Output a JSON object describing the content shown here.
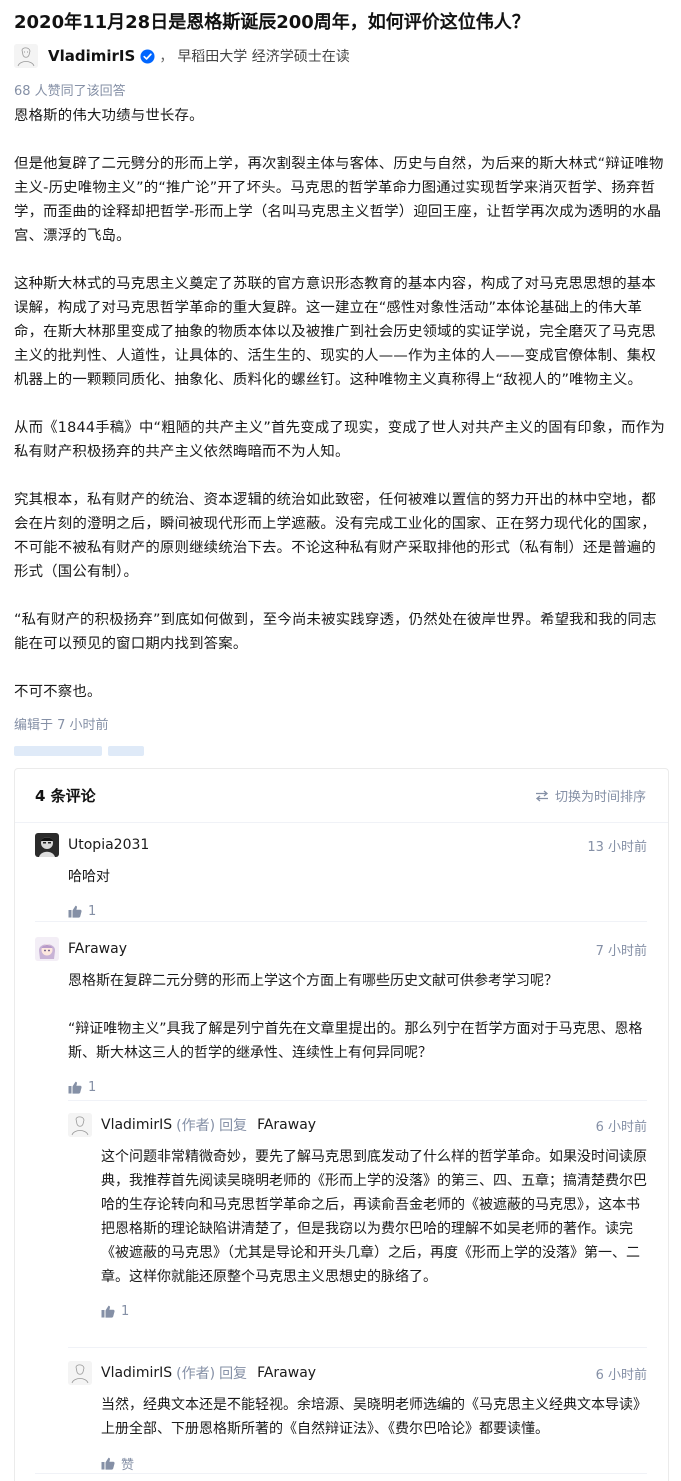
{
  "question": {
    "title": "2020年11月28日是恩格斯诞辰200周年，如何评价这位伟人？"
  },
  "author": {
    "name": "VladimirIS",
    "separator": "，",
    "bio": "早稻田大学 经济学硕士在读"
  },
  "answer": {
    "vote_summary": "68 人赞同了该回答",
    "paragraphs": [
      "恩格斯的伟大功绩与世长存。",
      "但是他复辟了二元劈分的形而上学，再次割裂主体与客体、历史与自然，为后来的斯大林式“辩证唯物主义-历史唯物主义”的“推广论”开了坏头。马克思的哲学革命力图通过实现哲学来消灭哲学、扬弃哲学，而歪曲的诠释却把哲学-形而上学（名叫马克思主义哲学）迎回王座，让哲学再次成为透明的水晶宫、漂浮的飞岛。",
      "这种斯大林式的马克思主义奠定了苏联的官方意识形态教育的基本内容，构成了对马克思思想的基本误解，构成了对马克思哲学革命的重大复辟。这一建立在“感性对象性活动”本体论基础上的伟大革命，在斯大林那里变成了抽象的物质本体以及被推广到社会历史领域的实证学说，完全磨灭了马克思主义的批判性、人道性，让具体的、活生生的、现实的人——作为主体的人——变成官僚体制、集权机器上的一颗颗同质化、抽象化、质料化的螺丝钉。这种唯物主义真称得上“敌视人的”唯物主义。",
      "从而《1844手稿》中“粗陋的共产主义”首先变成了现实，变成了世人对共产主义的固有印象，而作为私有财产积极扬弃的共产主义依然晦暗而不为人知。",
      "究其根本，私有财产的统治、资本逻辑的统治如此致密，任何被难以置信的努力开出的林中空地，都会在片刻的澄明之后，瞬间被现代形而上学遮蔽。没有完成工业化的国家、正在努力现代化的国家，不可能不被私有财产的原则继续统治下去。不论这种私有财产采取排他的形式（私有制）还是普遍的形式（国公有制）。",
      "“私有财产的积极扬弃”到底如何做到，至今尚未被实践穿透，仍然处在彼岸世界。希望我和我的同志能在可以预见的窗口期内找到答案。",
      "不可不察也。"
    ],
    "edit_time": "编辑于 7 小时前"
  },
  "comments": {
    "count_label": "4 条评论",
    "sort_label": "切换为时间排序",
    "items": [
      {
        "name": "Utopia2031",
        "time": "13 小时前",
        "texts": [
          "哈哈对"
        ],
        "likes": "1"
      },
      {
        "name": "FAraway",
        "time": "7 小时前",
        "texts": [
          "恩格斯在复辟二元分劈的形而上学这个方面上有哪些历史文献可供参考学习呢？",
          "“辩证唯物主义”具我了解是列宁首先在文章里提出的。那么列宁在哲学方面对于马克思、恩格斯、斯大林这三人的哲学的继承性、连续性上有何异同呢？"
        ],
        "likes": "1"
      },
      {
        "name": "VladimirIS",
        "author_tag": "(作者)",
        "reply_word": "回复",
        "reply_to": "FAraway",
        "time": "6 小时前",
        "texts": [
          "这个问题非常精微奇妙，要先了解马克思到底发动了什么样的哲学革命。如果没时间读原典，我推荐首先阅读吴晓明老师的《形而上学的没落》的第三、四、五章；搞清楚费尔巴哈的生存论转向和马克思哲学革命之后，再读俞吾金老师的《被遮蔽的马克思》，这本书把恩格斯的理论缺陷讲清楚了，但是我窃以为费尔巴哈的理解不如吴老师的著作。读完《被遮蔽的马克思》（尤其是导论和开头几章）之后，再度《形而上学的没落》第一、二章。这样你就能还原整个马克思主义思想史的脉络了。"
        ],
        "likes": "1"
      },
      {
        "name": "VladimirIS",
        "author_tag": "(作者)",
        "reply_word": "回复",
        "reply_to": "FAraway",
        "time": "6 小时前",
        "texts": [
          "当然，经典文本还是不能轻视。余培源、吴晓明老师选编的《马克思主义经典文本导读》上册全部、下册恩格斯所著的《自然辩证法》、《费尔巴哈论》都要读懂。"
        ],
        "likes": "赞"
      }
    ]
  }
}
